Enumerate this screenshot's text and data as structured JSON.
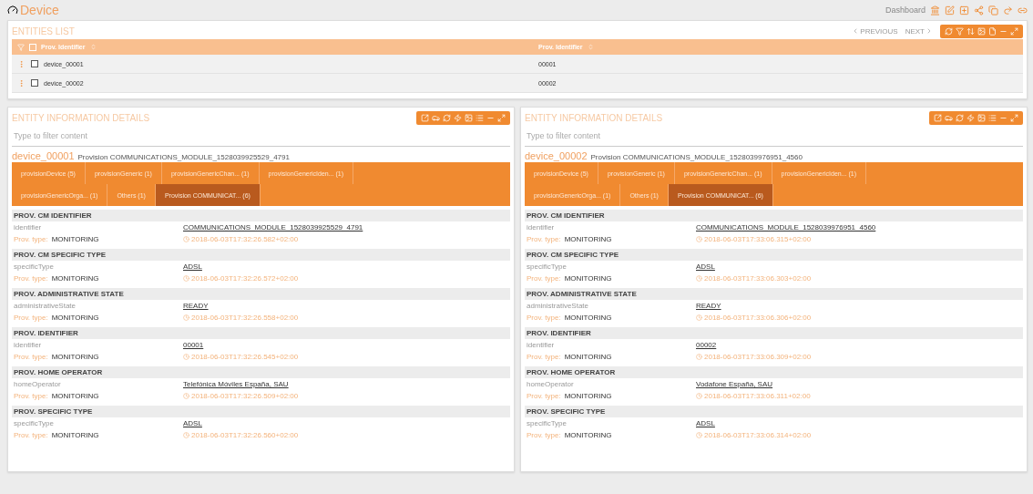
{
  "header": {
    "title": "Device",
    "breadcrumb": "Dashboard"
  },
  "entities_list": {
    "title": "ENTITIES LIST",
    "pager": {
      "previous": "PREVIOUS",
      "next": "NEXT"
    },
    "all_checked": false,
    "columns": [
      "Prov. Identifier",
      "Prov. Identifier"
    ],
    "rows": [
      {
        "checked": false,
        "cells": [
          "device_00001",
          "00001"
        ]
      },
      {
        "checked": false,
        "cells": [
          "device_00002",
          "00002"
        ]
      }
    ]
  },
  "details": [
    {
      "title": "ENTITY INFORMATION DETAILS",
      "filter_placeholder": "Type to filter content",
      "entity": "device_00001",
      "subtitle": "Provision COMMUNICATIONS_MODULE_1528039925529_4791",
      "tabs": [
        {
          "label": "provisionDevice (5)",
          "selected": false
        },
        {
          "label": "provisionGeneric (1)",
          "selected": false
        },
        {
          "label": "provisionGenericChan... (1)",
          "selected": false
        },
        {
          "label": "provisionGenericIden... (1)",
          "selected": false
        },
        {
          "label": "provisionGenericOrga... (1)",
          "selected": false
        },
        {
          "label": "Others (1)",
          "selected": false
        },
        {
          "label": "Provision COMMUNICAT... (6)",
          "selected": true
        }
      ],
      "sections": [
        {
          "heading": "PROV. CM IDENTIFIER",
          "attribute": "identifier",
          "type_label": "Prov. type:",
          "type": "MONITORING",
          "value": "COMMUNICATIONS_MODULE_1528039925529_4791",
          "timestamp": "2018-06-03T17:32:26.582+02:00"
        },
        {
          "heading": "PROV. CM SPECIFIC TYPE",
          "attribute": "specificType",
          "type_label": "Prov. type:",
          "type": "MONITORING",
          "value": "ADSL",
          "timestamp": "2018-06-03T17:32:26.572+02:00"
        },
        {
          "heading": "PROV. ADMINISTRATIVE STATE",
          "attribute": "administrativeState",
          "type_label": "Prov. type:",
          "type": "MONITORING",
          "value": "READY",
          "timestamp": "2018-06-03T17:32:26.558+02:00"
        },
        {
          "heading": "PROV. IDENTIFIER",
          "attribute": "identifier",
          "type_label": "Prov. type:",
          "type": "MONITORING",
          "value": "00001",
          "timestamp": "2018-06-03T17:32:26.545+02:00"
        },
        {
          "heading": "PROV. HOME OPERATOR",
          "attribute": "homeOperator",
          "type_label": "Prov. type:",
          "type": "MONITORING",
          "value": "Telefónica Móviles España, SAU",
          "timestamp": "2018-06-03T17:32:26.509+02:00"
        },
        {
          "heading": "PROV. SPECIFIC TYPE",
          "attribute": "specificType",
          "type_label": "Prov. type:",
          "type": "MONITORING",
          "value": "ADSL",
          "timestamp": "2018-06-03T17:32:26.560+02:00"
        }
      ]
    },
    {
      "title": "ENTITY INFORMATION DETAILS",
      "filter_placeholder": "Type to filter content",
      "entity": "device_00002",
      "subtitle": "Provision COMMUNICATIONS_MODULE_1528039976951_4560",
      "tabs": [
        {
          "label": "provisionDevice (5)",
          "selected": false
        },
        {
          "label": "provisionGeneric (1)",
          "selected": false
        },
        {
          "label": "provisionGenericChan... (1)",
          "selected": false
        },
        {
          "label": "provisionGenericIden... (1)",
          "selected": false
        },
        {
          "label": "provisionGenericOrga... (1)",
          "selected": false
        },
        {
          "label": "Others (1)",
          "selected": false
        },
        {
          "label": "Provision COMMUNICAT... (6)",
          "selected": true
        }
      ],
      "sections": [
        {
          "heading": "PROV. CM IDENTIFIER",
          "attribute": "identifier",
          "type_label": "Prov. type:",
          "type": "MONITORING",
          "value": "COMMUNICATIONS_MODULE_1528039976951_4560",
          "timestamp": "2018-06-03T17:33:06.315+02:00"
        },
        {
          "heading": "PROV. CM SPECIFIC TYPE",
          "attribute": "specificType",
          "type_label": "Prov. type:",
          "type": "MONITORING",
          "value": "ADSL",
          "timestamp": "2018-06-03T17:33:06.303+02:00"
        },
        {
          "heading": "PROV. ADMINISTRATIVE STATE",
          "attribute": "administrativeState",
          "type_label": "Prov. type:",
          "type": "MONITORING",
          "value": "READY",
          "timestamp": "2018-06-03T17:33:06.306+02:00"
        },
        {
          "heading": "PROV. IDENTIFIER",
          "attribute": "identifier",
          "type_label": "Prov. type:",
          "type": "MONITORING",
          "value": "00002",
          "timestamp": "2018-06-03T17:33:06.309+02:00"
        },
        {
          "heading": "PROV. HOME OPERATOR",
          "attribute": "homeOperator",
          "type_label": "Prov. type:",
          "type": "MONITORING",
          "value": "Vodafone España, SAU",
          "timestamp": "2018-06-03T17:33:06.311+02:00"
        },
        {
          "heading": "PROV. SPECIFIC TYPE",
          "attribute": "specificType",
          "type_label": "Prov. type:",
          "type": "MONITORING",
          "value": "ADSL",
          "timestamp": "2018-06-03T17:33:06.314+02:00"
        }
      ]
    }
  ]
}
